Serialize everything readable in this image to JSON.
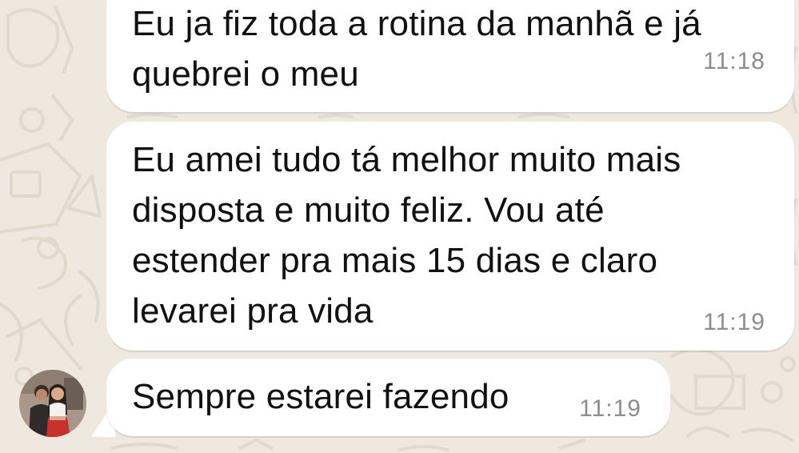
{
  "chat": {
    "messages": [
      {
        "lines": [
          "Eu ja fiz toda a rotina da manhã e já",
          "quebrei o meu"
        ],
        "time": "11:18"
      },
      {
        "lines": [
          "Eu amei tudo tá melhor muito mais",
          "disposta e muito feliz. Vou até",
          "estender pra mais 15 dias e claro",
          "levarei pra vida"
        ],
        "time": "11:19"
      },
      {
        "lines": [
          "Sempre estarei fazendo"
        ],
        "time": "11:19"
      }
    ],
    "sender_avatar": "contact-avatar-photo"
  },
  "colors": {
    "wallpaper": "#efe8df",
    "bubble": "#ffffff",
    "timestamp": "#8d8d8d",
    "text": "#111111"
  }
}
